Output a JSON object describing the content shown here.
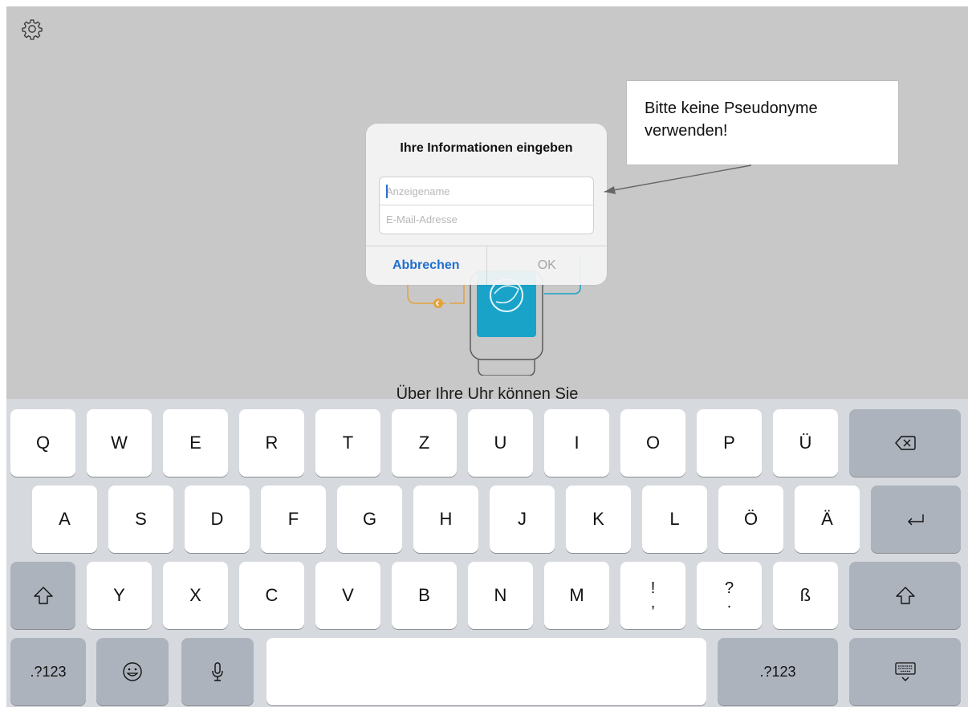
{
  "dialog": {
    "title": "Ihre Informationen eingeben",
    "name_placeholder": "Anzeigename",
    "email_placeholder": "E-Mail-Adresse",
    "cancel_label": "Abbrechen",
    "ok_label": "OK"
  },
  "callout": {
    "text": "Bitte keine Pseudonyme verwenden!"
  },
  "background": {
    "text": "Über Ihre Uhr können Sie"
  },
  "keyboard": {
    "row1": [
      "Q",
      "W",
      "E",
      "R",
      "T",
      "Z",
      "U",
      "I",
      "O",
      "P",
      "Ü"
    ],
    "row2": [
      "A",
      "S",
      "D",
      "F",
      "G",
      "H",
      "J",
      "K",
      "L",
      "Ö",
      "Ä"
    ],
    "row3": [
      "Y",
      "X",
      "C",
      "V",
      "B",
      "N",
      "M"
    ],
    "punct1": {
      "top": "!",
      "bottom": ","
    },
    "punct2": {
      "top": "?",
      "bottom": "."
    },
    "sharp_s": "ß",
    "numbers_left": ".?123",
    "numbers_right": ".?123"
  },
  "icons": {
    "settings": "gear-icon",
    "backspace": "backspace-icon",
    "return": "return-icon",
    "shift": "shift-icon",
    "emoji": "emoji-icon",
    "microphone": "microphone-icon",
    "hide_keyboard": "keyboard-hide-icon"
  },
  "colors": {
    "accent": "#1f6fd1",
    "watch_screen": "#1aa3c9",
    "illustration_line": "#e3a33b"
  }
}
